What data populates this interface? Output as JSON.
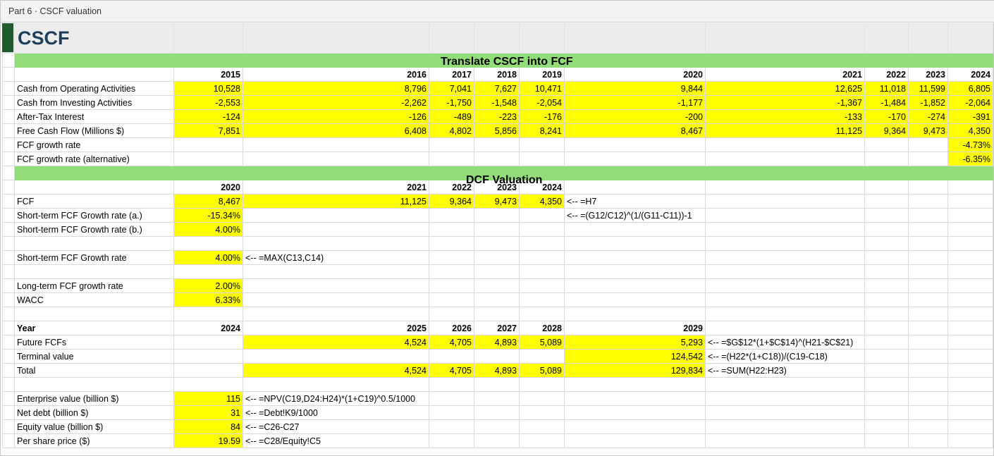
{
  "window": {
    "title": "Part 6 · CSCF valuation"
  },
  "sheet": {
    "title": "CSCF"
  },
  "sections": {
    "translate_title": "Translate CSCF into FCF",
    "dcf_title": "DCF Valuation"
  },
  "translate": {
    "years": [
      "2015",
      "2016",
      "2017",
      "2018",
      "2019",
      "2020",
      "2021",
      "2022",
      "2023",
      "2024"
    ],
    "rows": [
      {
        "label": "Cash from Operating Activities",
        "values": [
          "10,528",
          "8,796",
          "7,041",
          "7,627",
          "10,471",
          "9,844",
          "12,625",
          "11,018",
          "11,599",
          "6,805"
        ]
      },
      {
        "label": "Cash from Investing Activities",
        "values": [
          "-2,553",
          "-2,262",
          "-1,750",
          "-1,548",
          "-2,054",
          "-1,177",
          "-1,367",
          "-1,484",
          "-1,852",
          "-2,064"
        ]
      },
      {
        "label": "After-Tax Interest",
        "values": [
          "-124",
          "-126",
          "-489",
          "-223",
          "-176",
          "-200",
          "-133",
          "-170",
          "-274",
          "-391"
        ]
      },
      {
        "label": "Free Cash Flow (Millions $)",
        "values": [
          "7,851",
          "6,408",
          "4,802",
          "5,856",
          "8,241",
          "8,467",
          "11,125",
          "9,364",
          "9,473",
          "4,350"
        ]
      }
    ],
    "growth_label": "FCF growth rate",
    "growth_value": "-4.73%",
    "growth_alt_label": "FCF growth rate (alternative)",
    "growth_alt_value": "-6.35%"
  },
  "dcf": {
    "years": [
      "2020",
      "2021",
      "2022",
      "2023",
      "2024"
    ],
    "fcf_label": "FCF",
    "fcf_values": [
      "8,467",
      "11,125",
      "9,364",
      "9,473",
      "4,350"
    ],
    "fcf_note": "<-- =H7",
    "st_a_label": "Short-term FCF Growth rate (a.)",
    "st_a_value": "-15.34%",
    "st_a_note": "<-- =(G12/C12)^(1/(G11-C11))-1",
    "st_b_label": "Short-term FCF Growth rate (b.)",
    "st_b_value": "4.00%",
    "st_label": "Short-term FCF Growth rate",
    "st_value": "4.00%",
    "st_note": "<-- =MAX(C13,C14)",
    "lt_label": "Long-term FCF growth rate",
    "lt_value": "2.00%",
    "wacc_label": "WACC",
    "wacc_value": "6.33%",
    "year_label": "Year",
    "proj_years": [
      "2024",
      "2025",
      "2026",
      "2027",
      "2028",
      "2029"
    ],
    "future_label": "Future FCFs",
    "future_values": [
      "4,524",
      "4,705",
      "4,893",
      "5,089",
      "5,293"
    ],
    "future_note": "<-- =$G$12*(1+$C$14)^(H21-$C$21)",
    "terminal_label": "Terminal value",
    "terminal_value": "124,542",
    "terminal_note": "<-- =(H22*(1+C18))/(C19-C18)",
    "total_label": "Total",
    "total_values": [
      "4,524",
      "4,705",
      "4,893",
      "5,089",
      "129,834"
    ],
    "total_note": "<-- =SUM(H22:H23)",
    "ev_label": "Enterprise value (billion $)",
    "ev_value": "115",
    "ev_note": "<-- =NPV(C19,D24:H24)*(1+C19)^0.5/1000",
    "nd_label": "Net debt (billion $)",
    "nd_value": "31",
    "nd_note": "<-- =Debt!K9/1000",
    "eq_label": "Equity value (billion $)",
    "eq_value": "84",
    "eq_note": "<-- =C26-C27",
    "ps_label": "Per share price ($)",
    "ps_value": "19.59",
    "ps_note": "<-- =C28/Equity!C5"
  }
}
